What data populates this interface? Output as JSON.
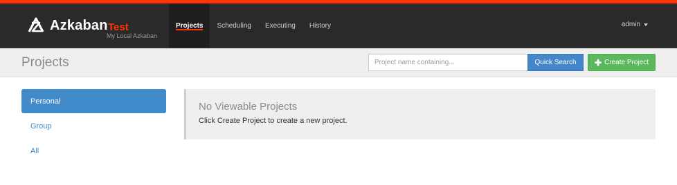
{
  "brand": {
    "name": "Azkaban",
    "env": "Test",
    "subtitle": "My Local Azkaban",
    "logo_icon": "azkaban-logo-icon"
  },
  "nav": {
    "items": [
      {
        "label": "Projects",
        "active": true
      },
      {
        "label": "Scheduling",
        "active": false
      },
      {
        "label": "Executing",
        "active": false
      },
      {
        "label": "History",
        "active": false
      }
    ],
    "user": "admin"
  },
  "header": {
    "title": "Projects",
    "search_placeholder": "Project name containing...",
    "search_button": "Quick Search",
    "create_button": "Create Project",
    "create_icon": "plus-icon"
  },
  "sidebar": {
    "items": [
      {
        "label": "Personal",
        "active": true
      },
      {
        "label": "Group",
        "active": false
      },
      {
        "label": "All",
        "active": false
      }
    ]
  },
  "main": {
    "title": "No Viewable Projects",
    "message": "Click Create Project to create a new project."
  },
  "colors": {
    "accent": "#ff3601",
    "navbar": "#2a2a2a",
    "primary": "#428bca",
    "success": "#5cb85c"
  }
}
